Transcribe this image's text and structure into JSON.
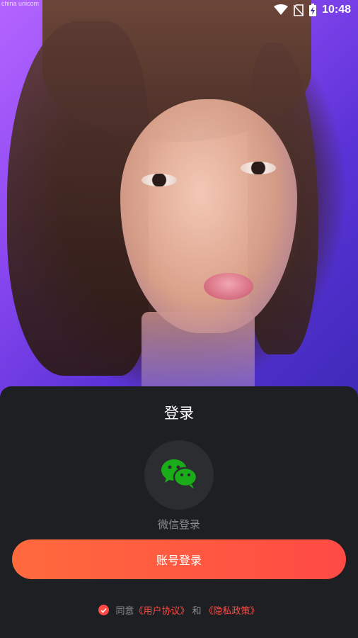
{
  "status_bar": {
    "carrier_text": "china unicom",
    "time": "10:48",
    "icons": [
      "wifi-icon",
      "no-sim-icon",
      "battery-charging-icon"
    ]
  },
  "hero": {
    "image": "portrait-photo"
  },
  "login_sheet": {
    "title": "登录",
    "wechat_label": "微信登录",
    "account_button_label": "账号登录",
    "agreement": {
      "prefix": "同意",
      "user_agreement": "《用户协议》",
      "conjunction": "和",
      "privacy_policy": "《隐私政策》",
      "checked": true
    }
  },
  "colors": {
    "accent": "#ff4a45",
    "accent_start": "#ff6a3d",
    "sheet_bg": "#1e1f22",
    "wechat_green": "#1aad19",
    "muted_text": "#8a8b90"
  }
}
